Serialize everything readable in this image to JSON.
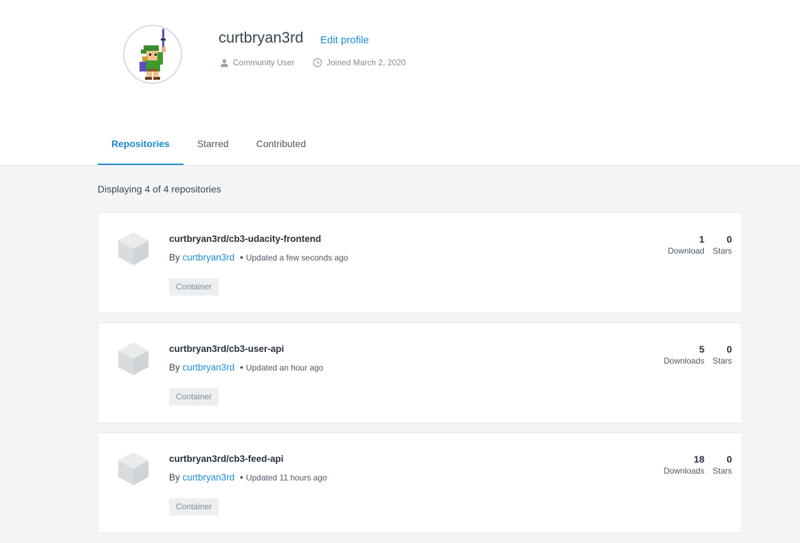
{
  "profile": {
    "username": "curtbryan3rd",
    "edit_label": "Edit profile",
    "role": "Community User",
    "joined": "Joined March 2, 2020"
  },
  "tabs": [
    {
      "label": "Repositories",
      "active": true
    },
    {
      "label": "Starred",
      "active": false
    },
    {
      "label": "Contributed",
      "active": false
    }
  ],
  "repo_count_text": "Displaying 4 of 4 repositories",
  "repositories": [
    {
      "name": "curtbryan3rd/cb3-udacity-frontend",
      "by_label": "By",
      "owner": "curtbryan3rd",
      "separator": "•",
      "updated": "Updated a few seconds ago",
      "tag": "Container",
      "downloads": "1",
      "downloads_label": "Download",
      "stars": "0",
      "stars_label": "Stars"
    },
    {
      "name": "curtbryan3rd/cb3-user-api",
      "by_label": "By",
      "owner": "curtbryan3rd",
      "separator": "•",
      "updated": "Updated an hour ago",
      "tag": "Container",
      "downloads": "5",
      "downloads_label": "Downloads",
      "stars": "0",
      "stars_label": "Stars"
    },
    {
      "name": "curtbryan3rd/cb3-feed-api",
      "by_label": "By",
      "owner": "curtbryan3rd",
      "separator": "•",
      "updated": "Updated 11 hours ago",
      "tag": "Container",
      "downloads": "18",
      "downloads_label": "Downloads",
      "stars": "0",
      "stars_label": "Stars"
    }
  ],
  "icons": {
    "role": "user-icon",
    "joined": "clock-icon",
    "repo": "cube-icon",
    "avatar": "pixel-hero-avatar"
  },
  "colors": {
    "accent": "#1d8ad1",
    "page_bg": "#f4f5f6",
    "tag_bg": "#eceff1"
  }
}
